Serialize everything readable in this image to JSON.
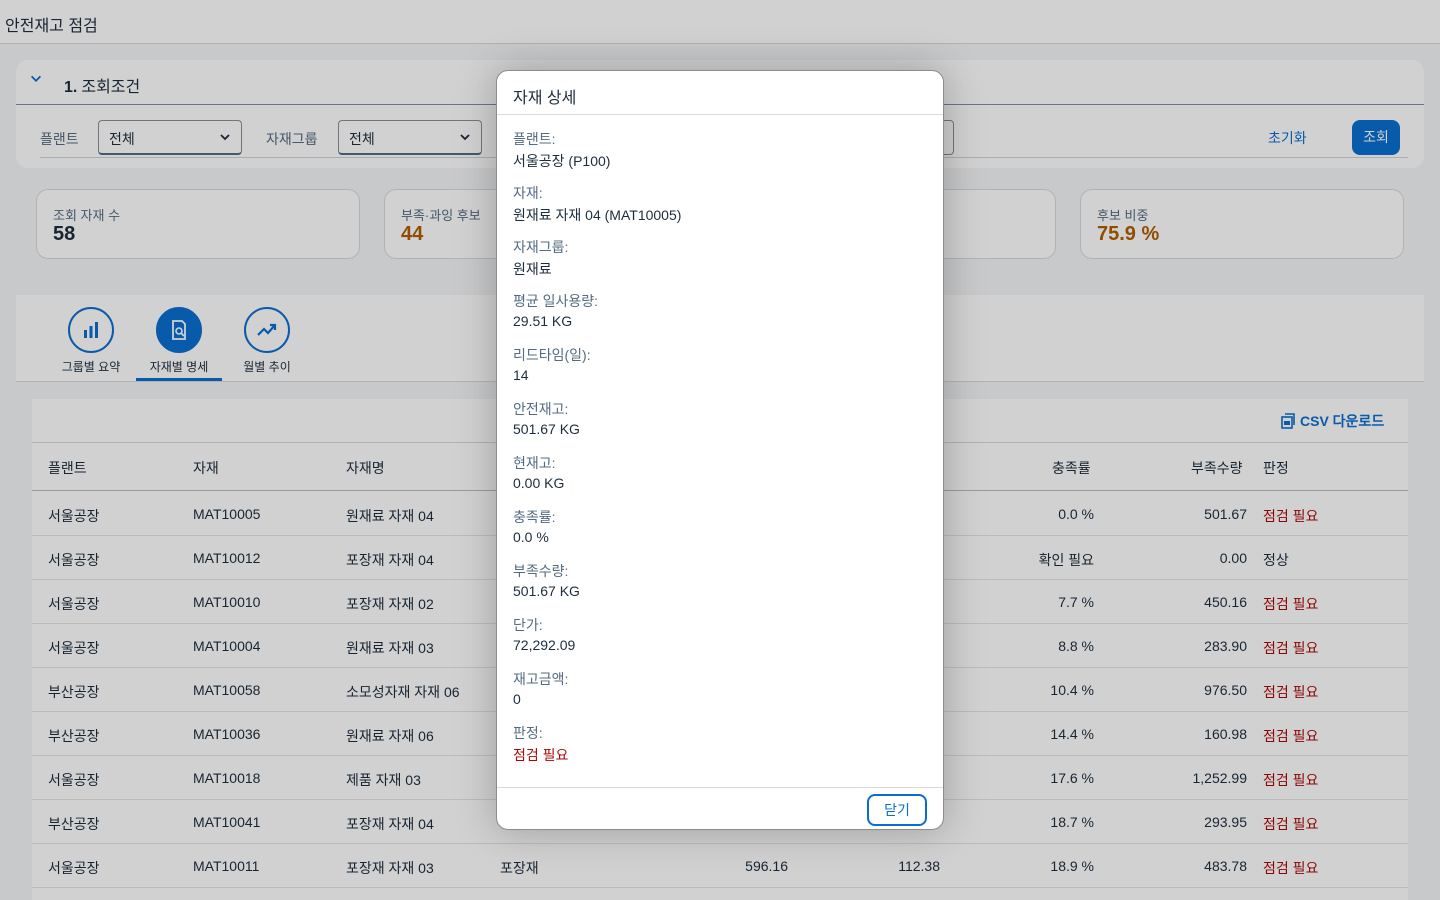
{
  "app": {
    "title": "안전재고 점검"
  },
  "filters": {
    "section_number": "1.",
    "section_title": "조회조건",
    "plant_label": "플랜트",
    "plant_value": "전체",
    "group_label": "자재그룹",
    "group_value": "전체",
    "reset_label": "초기화",
    "search_label": "조회"
  },
  "kpis": [
    {
      "label": "조회 자재 수",
      "value": "58",
      "color": "#1d2d3e"
    },
    {
      "label": "부족·과잉 후보",
      "value": "44",
      "color": "#b15d00"
    },
    {
      "label": "",
      "value": "",
      "color": "#1d2d3e"
    },
    {
      "label": "후보 비중",
      "value": "75.9 %",
      "color": "#b15d00"
    }
  ],
  "tabs": [
    {
      "label": "그룹별 요약",
      "icon": "bar-chart-icon"
    },
    {
      "label": "자재별 명세",
      "icon": "document-search-icon"
    },
    {
      "label": "월별 추이",
      "icon": "trend-up-icon"
    }
  ],
  "table": {
    "csv_label": "CSV 다운로드",
    "headers": {
      "plant": "플랜트",
      "material": "자재",
      "name": "자재명",
      "rate": "충족률",
      "short": "부족수량",
      "verdict": "판정"
    },
    "rows": [
      {
        "plant": "서울공장",
        "material": "MAT10005",
        "name": "원재료 자재 04",
        "group": "",
        "c1": "",
        "c2": "",
        "rate": "0.0 %",
        "short": "501.67",
        "verdict": "점검 필요",
        "bad": true
      },
      {
        "plant": "서울공장",
        "material": "MAT10012",
        "name": "포장재 자재 04",
        "group": "",
        "c1": "",
        "c2": "",
        "rate": "확인 필요",
        "short": "0.00",
        "verdict": "정상",
        "bad": false
      },
      {
        "plant": "서울공장",
        "material": "MAT10010",
        "name": "포장재 자재 02",
        "group": "",
        "c1": "",
        "c2": "",
        "rate": "7.7 %",
        "short": "450.16",
        "verdict": "점검 필요",
        "bad": true
      },
      {
        "plant": "서울공장",
        "material": "MAT10004",
        "name": "원재료 자재 03",
        "group": "",
        "c1": "",
        "c2": "",
        "rate": "8.8 %",
        "short": "283.90",
        "verdict": "점검 필요",
        "bad": true
      },
      {
        "plant": "부산공장",
        "material": "MAT10058",
        "name": "소모성자재 자재 06",
        "group": "",
        "c1": "",
        "c2": "",
        "rate": "10.4 %",
        "short": "976.50",
        "verdict": "점검 필요",
        "bad": true
      },
      {
        "plant": "부산공장",
        "material": "MAT10036",
        "name": "원재료 자재 06",
        "group": "",
        "c1": "",
        "c2": "",
        "rate": "14.4 %",
        "short": "160.98",
        "verdict": "점검 필요",
        "bad": true
      },
      {
        "plant": "서울공장",
        "material": "MAT10018",
        "name": "제품 자재 03",
        "group": "",
        "c1": "",
        "c2": "",
        "rate": "17.6 %",
        "short": "1,252.99",
        "verdict": "점검 필요",
        "bad": true
      },
      {
        "plant": "부산공장",
        "material": "MAT10041",
        "name": "포장재 자재 04",
        "group": "",
        "c1": "",
        "c2": "",
        "rate": "18.7 %",
        "short": "293.95",
        "verdict": "점검 필요",
        "bad": true
      },
      {
        "plant": "서울공장",
        "material": "MAT10011",
        "name": "포장재 자재 03",
        "group": "포장재",
        "c1": "596.16",
        "c2": "112.38",
        "rate": "18.9 %",
        "short": "483.78",
        "verdict": "점검 필요",
        "bad": true
      }
    ]
  },
  "dialog": {
    "title": "자재 상세",
    "close_label": "닫기",
    "fields": [
      {
        "label": "플랜트:",
        "value": "서울공장 (P100)"
      },
      {
        "label": "자재:",
        "value": "원재료 자재 04 (MAT10005)"
      },
      {
        "label": "자재그룹:",
        "value": "원재료"
      },
      {
        "label": "평균 일사용량:",
        "value": "29.51 KG"
      },
      {
        "label": "리드타임(일):",
        "value": "14"
      },
      {
        "label": "안전재고:",
        "value": "501.67 KG"
      },
      {
        "label": "현재고:",
        "value": "0.00 KG"
      },
      {
        "label": "충족률:",
        "value": "0.0 %"
      },
      {
        "label": "부족수량:",
        "value": "501.67 KG"
      },
      {
        "label": "단가:",
        "value": "72,292.09"
      },
      {
        "label": "재고금액:",
        "value": "0"
      },
      {
        "label": "판정:",
        "value": "점검 필요",
        "bad": true
      }
    ]
  },
  "colors": {
    "accent": "#0a6ed1",
    "negative": "#aa0808",
    "critical": "#b15d00"
  }
}
